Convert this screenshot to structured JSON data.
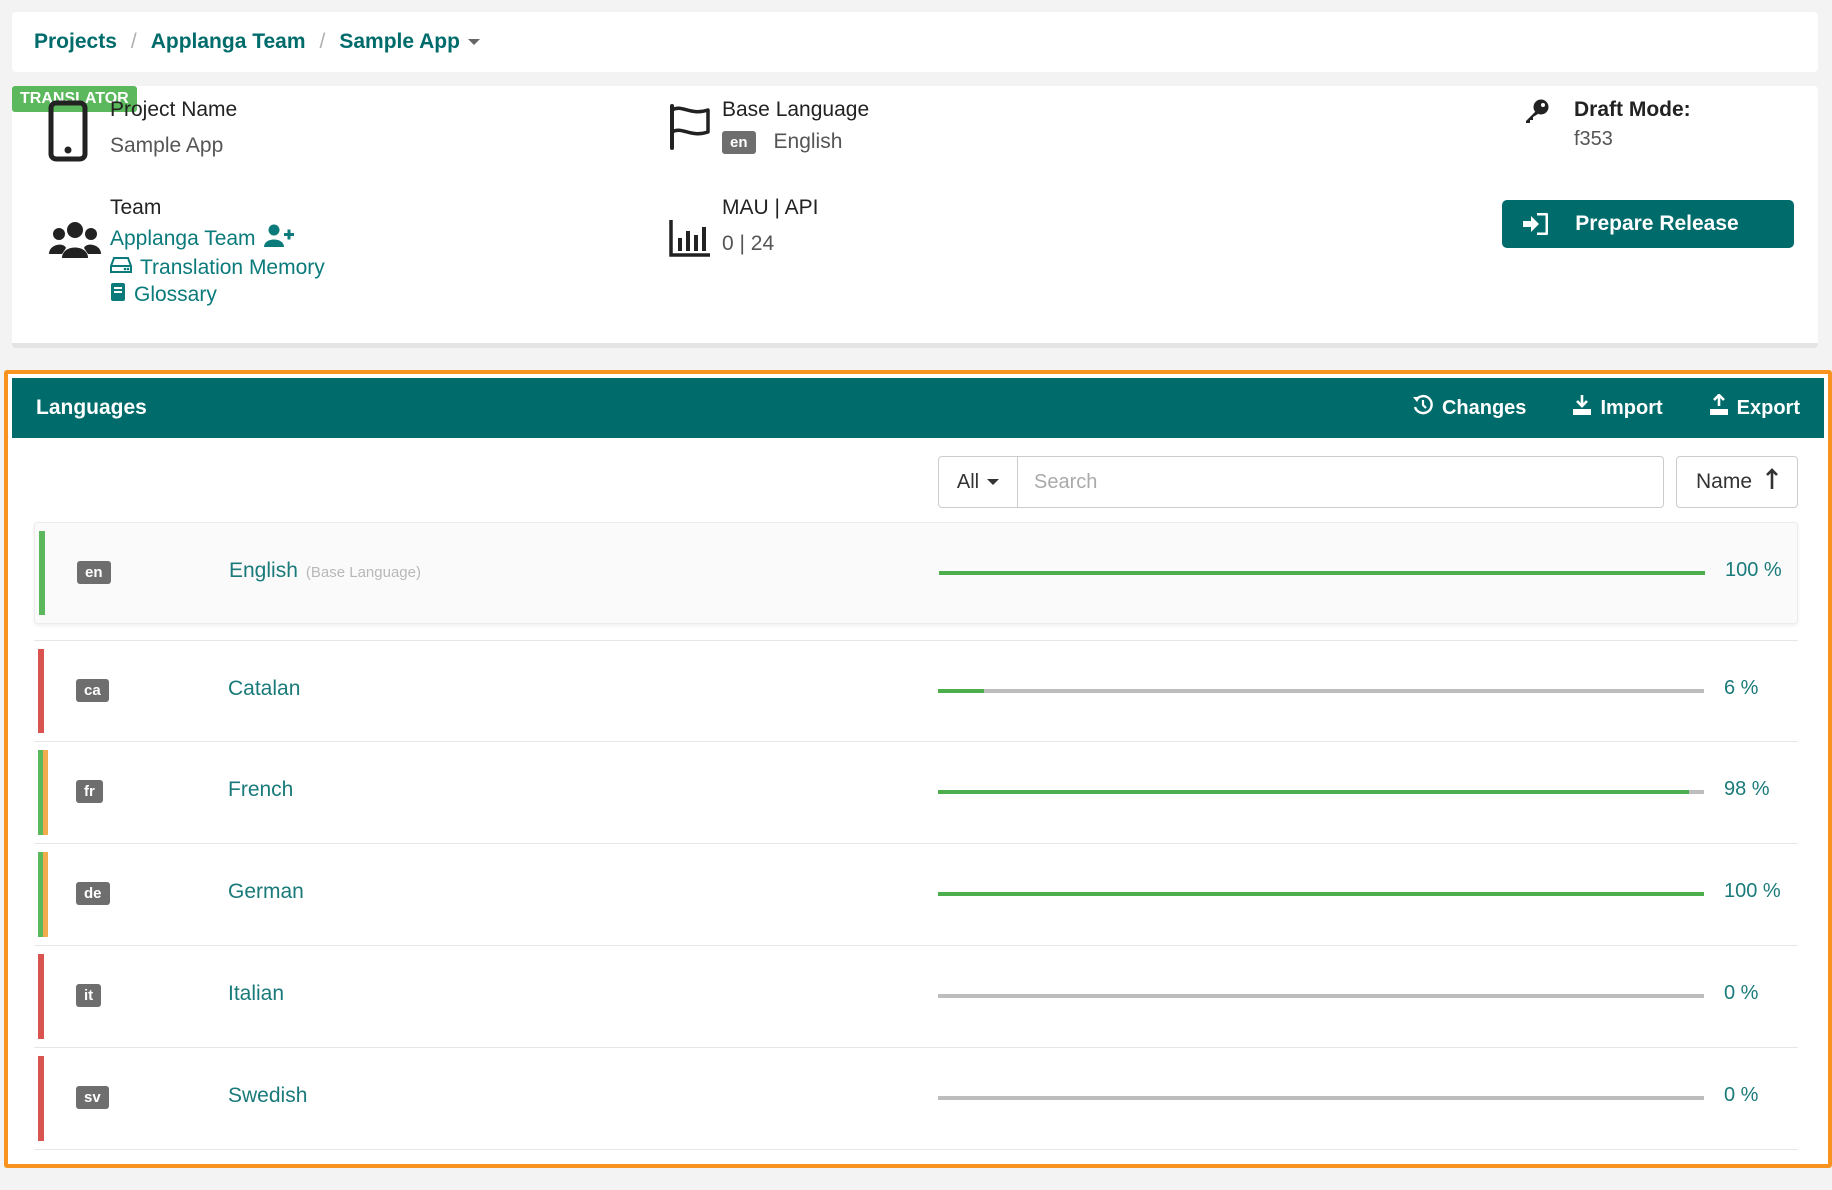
{
  "breadcrumb": {
    "projects": "Projects",
    "team": "Applanga Team",
    "app": "Sample App",
    "separator": "/"
  },
  "project": {
    "role_badge": "TRANSLATOR",
    "name_label": "Project Name",
    "name_value": "Sample App",
    "team_label": "Team",
    "team_link": "Applanga Team",
    "tm_link": "Translation Memory",
    "glossary_link": "Glossary",
    "base_lang_label": "Base Language",
    "base_lang_code": "en",
    "base_lang_value": "English",
    "mau_label": "MAU | API",
    "mau_value": "0 | 24",
    "draft_label": "Draft Mode:",
    "draft_value": "f353",
    "release_button": "Prepare Release"
  },
  "languages_panel": {
    "title": "Languages",
    "actions": {
      "changes": "Changes",
      "import": "Import",
      "export": "Export"
    },
    "filter": {
      "selected": "All",
      "search_placeholder": "Search",
      "sort_label": "Name"
    },
    "rows": [
      {
        "code": "en",
        "name": "English",
        "sub": "(Base Language)",
        "progress": 100,
        "percent_label": "100 %",
        "bar_color": "#5cb85c",
        "bar_color2": null
      },
      {
        "code": "ca",
        "name": "Catalan",
        "sub": "",
        "progress": 6,
        "percent_label": "6 %",
        "bar_color": "#d9534f",
        "bar_color2": null
      },
      {
        "code": "fr",
        "name": "French",
        "sub": "",
        "progress": 98,
        "percent_label": "98 %",
        "bar_color": "#5cb85c",
        "bar_color2": "#f0ad4e"
      },
      {
        "code": "de",
        "name": "German",
        "sub": "",
        "progress": 100,
        "percent_label": "100 %",
        "bar_color": "#5cb85c",
        "bar_color2": "#f0ad4e"
      },
      {
        "code": "it",
        "name": "Italian",
        "sub": "",
        "progress": 0,
        "percent_label": "0 %",
        "bar_color": "#d9534f",
        "bar_color2": null
      },
      {
        "code": "sv",
        "name": "Swedish",
        "sub": "",
        "progress": 0,
        "percent_label": "0 %",
        "bar_color": "#d9534f",
        "bar_color2": null
      }
    ]
  },
  "colors": {
    "brand": "#006b6b",
    "link": "#0b7a7a",
    "highlight_border": "#f7931e",
    "success": "#5cb85c"
  }
}
